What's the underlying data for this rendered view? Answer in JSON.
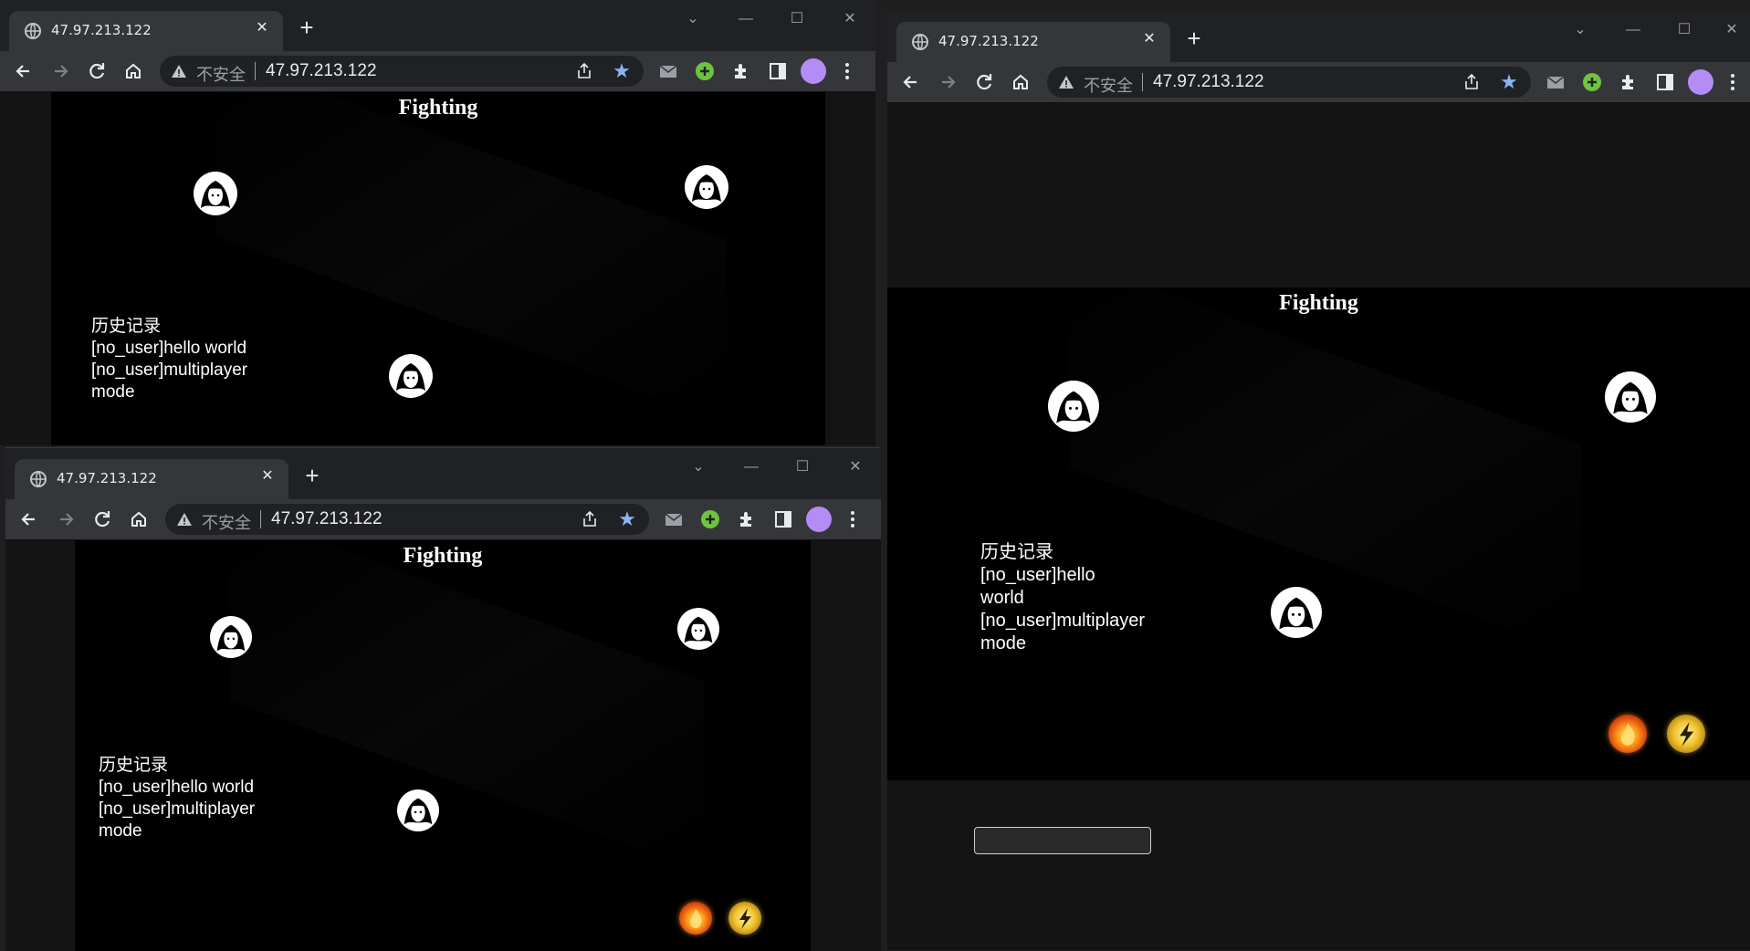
{
  "browser": {
    "tab_title": "47.97.213.122",
    "insecure_label": "不安全",
    "url": "47.97.213.122",
    "new_tab": "+",
    "close": "✕",
    "minimize": "—",
    "maximize": "☐",
    "tab_search": "⌄"
  },
  "game": {
    "title": "Fighting",
    "history_heading": "历史记录",
    "history": [
      "[no_user]hello world",
      "[no_user]multiplayer mode"
    ]
  },
  "icons": {
    "back": "arrow-left-icon",
    "forward": "arrow-right-icon",
    "reload": "reload-icon",
    "home": "home-icon",
    "share": "share-icon",
    "bookmark": "star-icon",
    "mail_ext": "mail-icon",
    "green_ext": "green-plus-icon",
    "extensions": "puzzle-icon",
    "side_panel": "side-panel-icon",
    "profile": "profile-avatar"
  },
  "colors": {
    "page_bg": "#000000",
    "chrome_titlebar": "#202124",
    "chrome_toolbar": "#35363a",
    "bookmark_star": "#8ab4f8",
    "profile": "#b48cf6"
  }
}
